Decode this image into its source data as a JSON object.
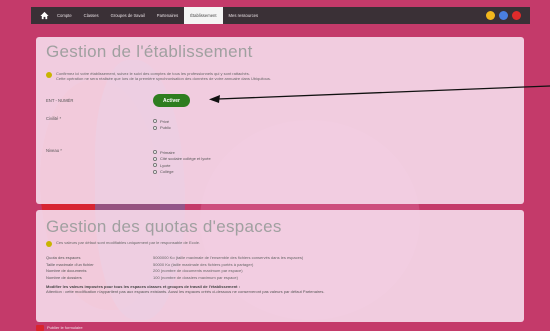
{
  "nav": {
    "items": [
      {
        "label": "Compte"
      },
      {
        "label": "Classes"
      },
      {
        "label": "Groupes de travail"
      },
      {
        "label": "Partenaires"
      },
      {
        "label": "Établissement",
        "active": true
      },
      {
        "label": "Mes ressources"
      }
    ],
    "icon_colors": [
      "#f2b61d",
      "#4a7fe0",
      "#e02b2b"
    ]
  },
  "gestion": {
    "title": "Gestion de l'établissement",
    "info_line1": "Confirmez ici votre établissement, suivez le suivi des comptes de tous les professionnels qui y sont rattachés.",
    "info_line2": "Cette opération ne sera réalisée que lors de la première synchronisation des données de votre annuaire dans Ubiquitous.",
    "ent_label": "ENT - NUMÉR",
    "activate_label": "Activer",
    "civilite_label": "Civilité *",
    "civilite_options": [
      "Privé",
      "Public"
    ],
    "niveau_label": "Niveau *",
    "niveau_options": [
      "Primaire",
      "Cité scolaire collège et lycée",
      "Lycée",
      "Collège"
    ]
  },
  "quotas": {
    "title": "Gestion des quotas d'espaces",
    "info": "Ces valeurs par défaut sont modifiables uniquement par le responsable de Ecole.",
    "rows": [
      {
        "key": "Quota des espaces",
        "value": "5000000 Ko (taille maximale de l'ensemble des fichiers conservés dans les espaces)"
      },
      {
        "key": "Taille maximale d'un fichier",
        "value": "50000 Ko (taille maximale des fichiers portés à partager)"
      },
      {
        "key": "Nombre de documents",
        "value": "200 (nombre de documents maximum par espace)"
      },
      {
        "key": "Nombre de dossiers",
        "value": "100 (nombre de dossiers maximum par espace)"
      }
    ],
    "note_bold": "Modifier les valeurs imposées pour tous les espaces classes et groupes de travail de l'établissement :",
    "note_text": "Attention : cette modification n'appartient pas aux espaces existants. Aussi les espaces créés ci-dessous ne conserveront pas valeurs par défaut Partenaires."
  },
  "footer": {
    "label": "Publier le formulaire"
  }
}
